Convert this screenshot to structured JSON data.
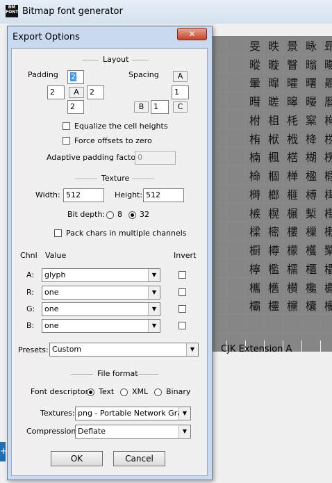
{
  "main_window": {
    "icon_text": "BM FONT",
    "title": "Bitmap font generator",
    "status_text": "CJK  Extension A",
    "side_handle_text": "+",
    "glyphs": [
      "旻",
      "昳",
      "景",
      "昹",
      "昻",
      "暰",
      "暶",
      "瞖",
      "暡",
      "暘",
      "暈",
      "暭",
      "曤",
      "曙",
      "曏",
      "暳",
      "暛",
      "暤",
      "暥",
      "暦",
      "柎",
      "柤",
      "枆",
      "梥",
      "栒",
      "栯",
      "栿",
      "栰",
      "栙",
      "梤",
      "楠",
      "楓",
      "楛",
      "楜",
      "楞",
      "椧",
      "棝",
      "椫",
      "楹",
      "椴",
      "榯",
      "榔",
      "榧",
      "榑",
      "榵",
      "槉",
      "榥",
      "榐",
      "槧",
      "槥",
      "樑",
      "樒",
      "樓",
      "樔",
      "樕",
      "橱",
      "樽",
      "檬",
      "檴",
      "檠",
      "檸",
      "檻",
      "檽",
      "櫃",
      "櫑",
      "欈",
      "欍",
      "櫕",
      "欃",
      "欁",
      "欛",
      "欞",
      "欓",
      "欜",
      "欗"
    ]
  },
  "dialog": {
    "title": "Export Options",
    "close_glyph": "✕",
    "layout_section": "Layout",
    "padding_label": "Padding",
    "spacing_label": "Spacing",
    "padding_up": "2",
    "padding_left": "2",
    "padding_center": "A",
    "padding_right": "2",
    "padding_down": "2",
    "spacing_a": "A",
    "spacing_horiz": "1",
    "spacing_b": "B",
    "spacing_vert": "1",
    "spacing_c": "C",
    "equalize_label": "Equalize the cell heights",
    "force_offsets_label": "Force offsets to zero",
    "adaptive_label": "Adaptive padding factor:",
    "adaptive_value": "0",
    "texture_section": "Texture",
    "width_label": "Width:",
    "width_value": "512",
    "height_label": "Height:",
    "height_value": "512",
    "bitdepth_label": "Bit depth:",
    "bitdepth_8": "8",
    "bitdepth_32": "32",
    "pack_chars_label": "Pack chars in multiple channels",
    "chnl_header": "Chnl",
    "value_header": "Value",
    "invert_header": "Invert",
    "channels": [
      {
        "name": "A:",
        "value": "glyph"
      },
      {
        "name": "R:",
        "value": "one"
      },
      {
        "name": "G:",
        "value": "one"
      },
      {
        "name": "B:",
        "value": "one"
      }
    ],
    "presets_label": "Presets:",
    "presets_value": "Custom",
    "file_format_section": "File format",
    "descriptor_label": "Font descriptor:",
    "desc_text": "Text",
    "desc_xml": "XML",
    "desc_binary": "Binary",
    "textures_label": "Textures:",
    "textures_value": "png - Portable Network Graphics",
    "compression_label": "Compression:",
    "compression_value": "Deflate",
    "ok_label": "OK",
    "cancel_label": "Cancel",
    "dropdown_arrow": "▼"
  }
}
